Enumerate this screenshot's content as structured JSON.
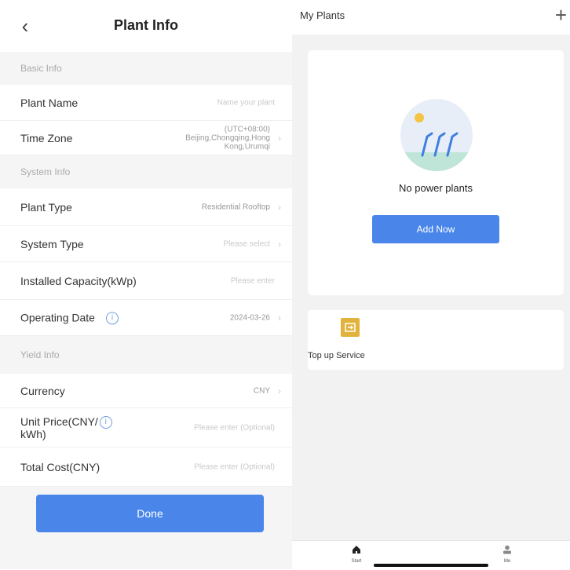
{
  "plant_info": {
    "title": "Plant Info",
    "back_icon": "chevron-left-icon",
    "sections": {
      "basic": "Basic Info",
      "system": "System Info",
      "yield": "Yield Info"
    },
    "rows": {
      "plant_name": {
        "label": "Plant Name",
        "placeholder": "Name your plant"
      },
      "time_zone": {
        "label": "Time Zone",
        "value_line1": "(UTC+08:00)",
        "value_line2": "Beijing,Chongqing,Hong",
        "value_line3": "Kong,Urumqi"
      },
      "plant_type": {
        "label": "Plant Type",
        "value": "Residential Rooftop"
      },
      "system_type": {
        "label": "System Type",
        "placeholder": "Please select"
      },
      "installed_capacity": {
        "label": "Installed Capacity(kWp)",
        "placeholder": "Please enter"
      },
      "operating_date": {
        "label": "Operating Date",
        "value": "2024-03-26"
      },
      "currency": {
        "label": "Currency",
        "value": "CNY"
      },
      "unit_price": {
        "label_line1": "Unit Price(CNY/",
        "label_line2": "kWh)",
        "placeholder": "Please enter (Optional)"
      },
      "total_cost": {
        "label": "Total Cost(CNY)",
        "placeholder": "Please enter (Optional)"
      }
    },
    "done_label": "Done"
  },
  "my_plants": {
    "title": "My Plants",
    "add_icon": "plus-icon",
    "empty_text": "No power plants",
    "add_now_label": "Add Now",
    "service_label": "Top up Service",
    "tabs": [
      {
        "label": "Start",
        "icon": "home-icon"
      },
      {
        "label": "Me",
        "icon": "person-icon"
      }
    ]
  },
  "colors": {
    "accent": "#4a86ea",
    "section_bg": "#f5f5f6",
    "service_icon": "#e2b33c"
  }
}
